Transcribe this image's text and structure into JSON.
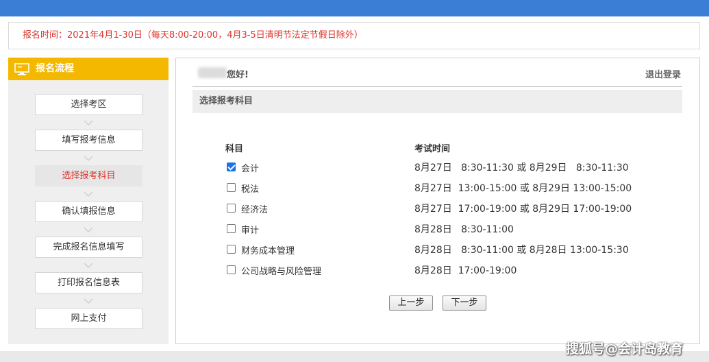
{
  "notice": {
    "text": "报名时间：2021年4月1-30日（每天8:00-20:00，4月3-5日清明节法定节假日除外）"
  },
  "sidebar": {
    "title": "报名流程",
    "icon": "monitor-icon",
    "steps": [
      {
        "label": "选择考区",
        "active": false
      },
      {
        "label": "填写报考信息",
        "active": false
      },
      {
        "label": "选择报考科目",
        "active": true
      },
      {
        "label": "确认填报信息",
        "active": false
      },
      {
        "label": "完成报名信息填写",
        "active": false
      },
      {
        "label": "打印报名信息表",
        "active": false
      },
      {
        "label": "网上支付",
        "active": false
      }
    ]
  },
  "main": {
    "greeting": "您好!",
    "logout": "退出登录",
    "section_title": "选择报考科目",
    "columns": {
      "subject": "科目",
      "time": "考试时间"
    },
    "subjects": [
      {
        "name": "会计",
        "checked": true,
        "time": "8月27日   8:30-11:30 或 8月29日   8:30-11:30"
      },
      {
        "name": "税法",
        "checked": false,
        "time": "8月27日  13:00-15:00 或 8月29日 13:00-15:00"
      },
      {
        "name": "经济法",
        "checked": false,
        "time": "8月27日  17:00-19:00 或 8月29日 17:00-19:00"
      },
      {
        "name": "审计",
        "checked": false,
        "time": "8月28日   8:30-11:00"
      },
      {
        "name": "财务成本管理",
        "checked": false,
        "time": "8月28日   8:30-11:00 或 8月28日 13:00-15:30"
      },
      {
        "name": "公司战略与风险管理",
        "checked": false,
        "time": "8月28日  17:00-19:00"
      }
    ],
    "prev_label": "上一步",
    "next_label": "下一步"
  },
  "watermark": "搜狐号@会计岛教育",
  "colors": {
    "top_bar": "#3a7fd5",
    "sidebar_header": "#f5b800",
    "notice_text": "#d9342b",
    "active_step_text": "#d9342b"
  }
}
